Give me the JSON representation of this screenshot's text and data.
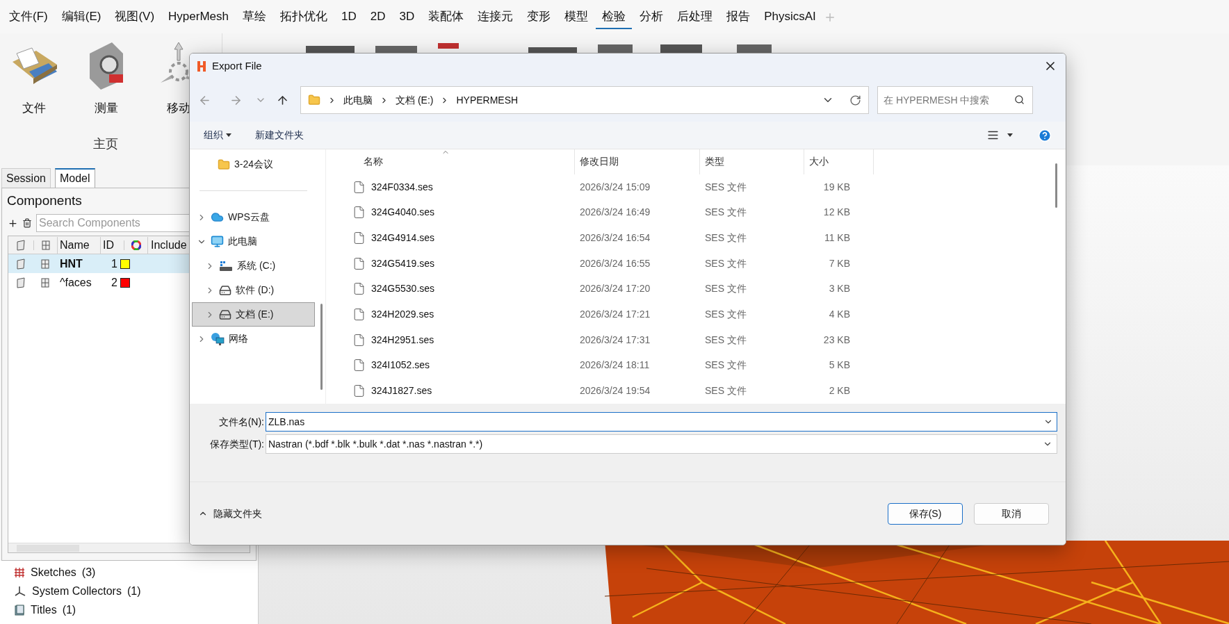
{
  "menu": [
    {
      "label": "文件(F)",
      "selected": false
    },
    {
      "label": "编辑(E)",
      "selected": false
    },
    {
      "label": "视图(V)",
      "selected": false
    },
    {
      "label": "HyperMesh",
      "selected": false
    },
    {
      "label": "草绘",
      "selected": false
    },
    {
      "label": "拓扑优化",
      "selected": false
    },
    {
      "label": "1D",
      "selected": false
    },
    {
      "label": "2D",
      "selected": false
    },
    {
      "label": "3D",
      "selected": false
    },
    {
      "label": "装配体",
      "selected": false
    },
    {
      "label": "连接元",
      "selected": false
    },
    {
      "label": "变形",
      "selected": false
    },
    {
      "label": "模型",
      "selected": false
    },
    {
      "label": "检验",
      "selected": true
    },
    {
      "label": "分析",
      "selected": false
    },
    {
      "label": "后处理",
      "selected": false
    },
    {
      "label": "报告",
      "selected": false
    },
    {
      "label": "PhysicsAI",
      "selected": false
    }
  ],
  "ribbon": {
    "tools": [
      {
        "label": "文件",
        "kind": "file"
      },
      {
        "label": "测量",
        "kind": "measure"
      },
      {
        "label": "移动",
        "kind": "move"
      }
    ],
    "group_label": "主页"
  },
  "browser_tabs": [
    {
      "label": "Session",
      "selected": false
    },
    {
      "label": "Model",
      "selected": true
    }
  ],
  "components": {
    "title": "Components",
    "search_placeholder": "Search Components",
    "columns": [
      "Name",
      "ID",
      "Include"
    ],
    "rows": [
      {
        "name": "HNT",
        "id": "1",
        "color": "#ffff00",
        "selected": true
      },
      {
        "name": "^faces",
        "id": "2",
        "color": "#ff0000",
        "selected": false
      }
    ]
  },
  "model_tree": [
    {
      "label": "Sketches",
      "count": "(3)",
      "kind": "sketch"
    },
    {
      "label": "System Collectors",
      "count": "(1)",
      "kind": "system"
    },
    {
      "label": "Titles",
      "count": "(1)",
      "kind": "title"
    }
  ],
  "dialog": {
    "title": "Export File",
    "breadcrumb": [
      "此电脑",
      "文档 (E:)",
      "HYPERMESH"
    ],
    "search_placeholder": "在 HYPERMESH 中搜索",
    "organize": "组织",
    "new_folder": "新建文件夹",
    "nav": [
      {
        "label": "3-24会议",
        "kind": "folder",
        "selected": false
      },
      {
        "label": "WPS云盘",
        "kind": "cloud",
        "expanded": false,
        "selected": false
      },
      {
        "label": "此电脑",
        "kind": "pc",
        "expanded": true,
        "selected": false,
        "children": [
          {
            "label": "系统 (C:)",
            "kind": "system-drive",
            "expanded": false,
            "selected": false
          },
          {
            "label": "软件 (D:)",
            "kind": "drive",
            "expanded": false,
            "selected": false
          },
          {
            "label": "文档 (E:)",
            "kind": "drive",
            "expanded": false,
            "selected": true
          }
        ]
      },
      {
        "label": "网络",
        "kind": "network",
        "expanded": false,
        "selected": false
      }
    ],
    "columns": [
      "名称",
      "修改日期",
      "类型",
      "大小"
    ],
    "files": [
      {
        "name": "324F0334.ses",
        "date": "2026/3/24 15:09",
        "type": "SES 文件",
        "size": "19 KB"
      },
      {
        "name": "324G4040.ses",
        "date": "2026/3/24 16:49",
        "type": "SES 文件",
        "size": "12 KB"
      },
      {
        "name": "324G4914.ses",
        "date": "2026/3/24 16:54",
        "type": "SES 文件",
        "size": "11 KB"
      },
      {
        "name": "324G5419.ses",
        "date": "2026/3/24 16:55",
        "type": "SES 文件",
        "size": "7 KB"
      },
      {
        "name": "324G5530.ses",
        "date": "2026/3/24 17:20",
        "type": "SES 文件",
        "size": "3 KB"
      },
      {
        "name": "324H2029.ses",
        "date": "2026/3/24 17:21",
        "type": "SES 文件",
        "size": "4 KB"
      },
      {
        "name": "324H2951.ses",
        "date": "2026/3/24 17:31",
        "type": "SES 文件",
        "size": "23 KB"
      },
      {
        "name": "324I1052.ses",
        "date": "2026/3/24 18:11",
        "type": "SES 文件",
        "size": "5 KB"
      },
      {
        "name": "324J1827.ses",
        "date": "2026/3/24 19:54",
        "type": "SES 文件",
        "size": "2 KB"
      }
    ],
    "filename_label": "文件名(N):",
    "filename": "ZLB.nas",
    "filetype_label": "保存类型(T):",
    "filetype": "Nastran (*.bdf *.blk *.bulk *.dat *.nas *.nastran *.*)",
    "hide_folders": "隐藏文件夹",
    "save": "保存(S)",
    "cancel": "取消"
  }
}
